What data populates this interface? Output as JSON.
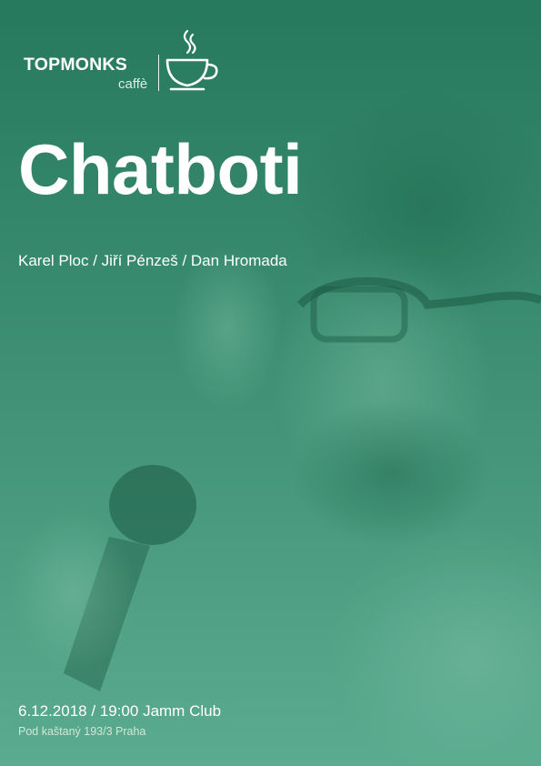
{
  "logo": {
    "wordmark": "TOPMONKS",
    "subtitle": "caffè",
    "icon": "coffee-cup-icon"
  },
  "poster": {
    "title": "Chatboti",
    "speakers": "Karel Ploc / Jiří Pénzeš / Dan Hromada",
    "date_time_venue": "6.12.2018 / 19:00 Jamm Club",
    "address": "Pod kaštaný 193/3 Praha"
  },
  "colors": {
    "overlay_top": "#26795d",
    "overlay_bottom": "#5aab8f",
    "text": "#ffffff"
  }
}
